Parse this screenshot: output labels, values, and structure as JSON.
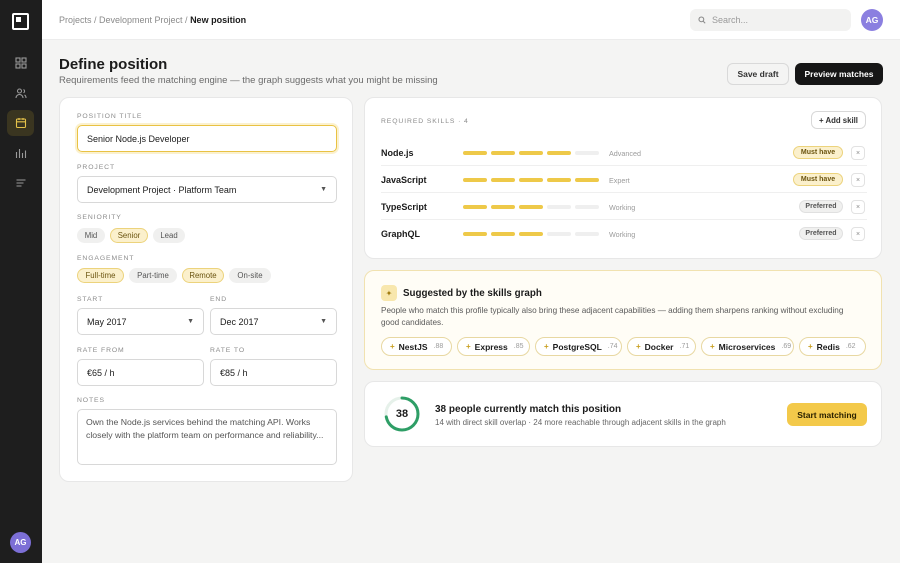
{
  "breadcrumb": {
    "path": "Projects / Development Project / ",
    "current": "New position"
  },
  "search": {
    "placeholder": "Search..."
  },
  "user": {
    "initials": "AG"
  },
  "header": {
    "title": "Define position",
    "subtitle": "Requirements feed the matching engine — the graph suggests what you might be missing",
    "save_label": "Save draft",
    "preview_label": "Preview matches"
  },
  "form": {
    "position_title_label": "POSITION TITLE",
    "position_title_value": "Senior Node.js Developer",
    "project_label": "PROJECT",
    "project_value": "Development Project · Platform Team",
    "seniority_label": "SENIORITY",
    "seniority": [
      {
        "label": "Mid",
        "selected": false
      },
      {
        "label": "Senior",
        "selected": true
      },
      {
        "label": "Lead",
        "selected": false
      }
    ],
    "engagement_label": "ENGAGEMENT",
    "engagement": [
      {
        "label": "Full-time",
        "selected": true
      },
      {
        "label": "Part-time",
        "selected": false
      },
      {
        "label": "Remote",
        "selected": true
      },
      {
        "label": "On-site",
        "selected": false
      }
    ],
    "start_label": "START",
    "start_value": "May 2017",
    "end_label": "END",
    "end_value": "Dec 2017",
    "rate_from_label": "RATE FROM",
    "rate_from_value": "€65 / h",
    "rate_to_label": "RATE TO",
    "rate_to_value": "€85 / h",
    "notes_label": "NOTES",
    "notes_value": "Own the Node.js services behind the matching API. Works closely with the platform team on performance and reliability..."
  },
  "skills": {
    "header": "REQUIRED SKILLS · 4",
    "add_label": "+ Add skill",
    "remove_glyph": "×",
    "items": [
      {
        "name": "Node.js",
        "level": 4,
        "level_label": "Advanced",
        "priority": "Must have"
      },
      {
        "name": "JavaScript",
        "level": 5,
        "level_label": "Expert",
        "priority": "Must have"
      },
      {
        "name": "TypeScript",
        "level": 3,
        "level_label": "Working",
        "priority": "Preferred"
      },
      {
        "name": "GraphQL",
        "level": 3,
        "level_label": "Working",
        "priority": "Preferred"
      }
    ]
  },
  "suggestions": {
    "title": "Suggested by the skills graph",
    "description": "People who match this profile typically also bring these adjacent capabilities — adding them sharpens ranking without excluding good candidates.",
    "items": [
      {
        "name": "NestJS",
        "score": ".88"
      },
      {
        "name": "Express",
        "score": ".85"
      },
      {
        "name": "PostgreSQL",
        "score": ".74"
      },
      {
        "name": "Docker",
        "score": ".71"
      },
      {
        "name": "Microservices",
        "score": ".69"
      },
      {
        "name": "Redis",
        "score": ".62"
      }
    ]
  },
  "match": {
    "count": "38",
    "fill": 0.72,
    "title": "38 people currently match this position",
    "subtitle": "14 with direct skill overlap · 24 more reachable through adjacent skills in the graph",
    "start_label": "Start matching"
  },
  "colors": {
    "accent": "#eec949",
    "ring": "#2e9e66",
    "dark": "#161616"
  }
}
